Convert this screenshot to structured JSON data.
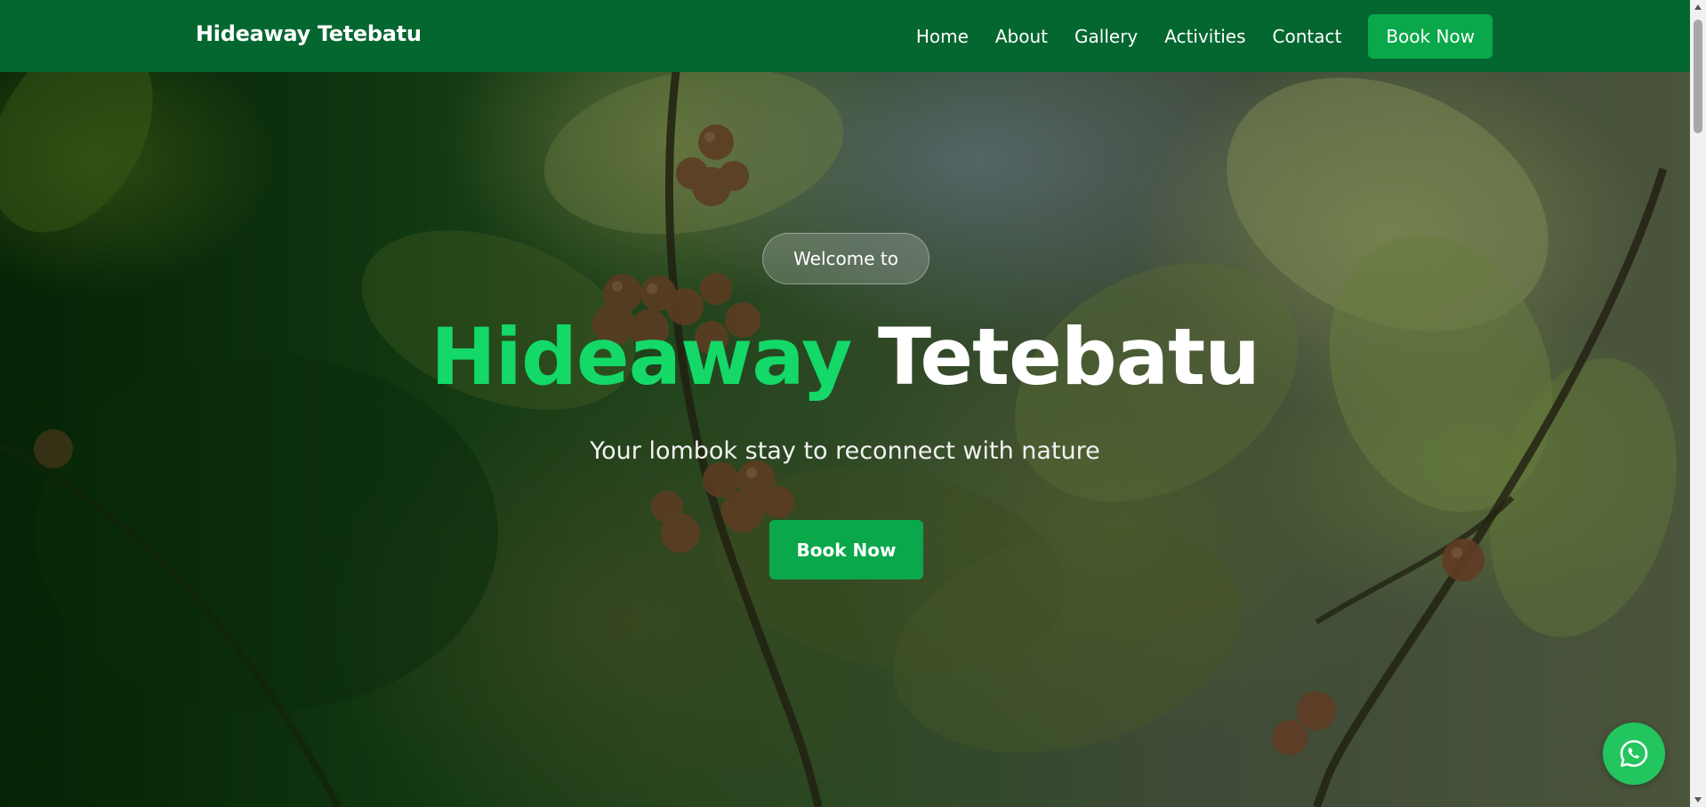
{
  "navbar": {
    "brand": "Hideaway Tetebatu",
    "links": [
      "Home",
      "About",
      "Gallery",
      "Activities",
      "Contact"
    ],
    "book_label": "Book Now"
  },
  "hero": {
    "welcome": "Welcome to",
    "title_green": "Hideaway",
    "title_white": "Tetebatu",
    "subtitle": "Your lombok stay to reconnect with nature",
    "book_label": "Book Now"
  },
  "floating": {
    "whatsapp_icon": "whatsapp-icon"
  },
  "colors": {
    "navbar_bg": "#046730",
    "accent": "#0aa84a",
    "title_green": "#14d868",
    "whatsapp": "#22c55e"
  }
}
